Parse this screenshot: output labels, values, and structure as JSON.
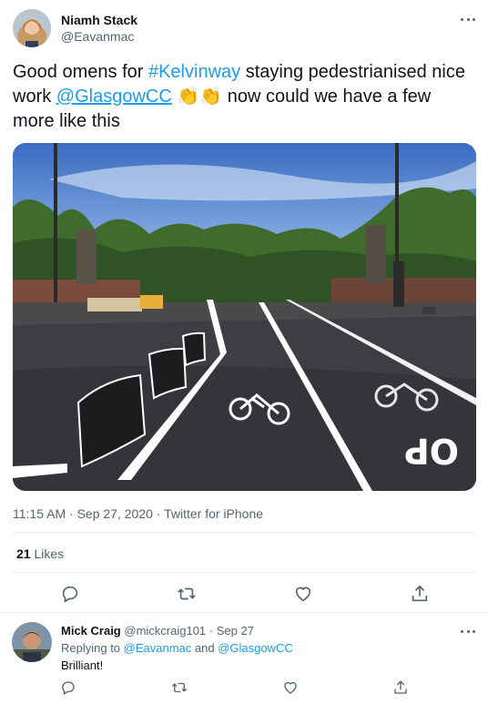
{
  "tweet": {
    "author_name": "Niamh Stack",
    "author_handle": "@Eavanmac",
    "text_part1": "Good omens for ",
    "hashtag": "#Kelvinway",
    "text_part2": " staying pedestrianised nice work ",
    "mention": "@GlasgowCC",
    "emoji": "👏👏",
    "text_part3": " now could we have a few more like this",
    "time": "11:15 AM",
    "date": "Sep 27, 2020",
    "source": "Twitter for iPhone",
    "likes_count": "21",
    "likes_label": "Likes"
  },
  "reply": {
    "author_name": "Mick Craig",
    "author_handle": "@mickcraig101",
    "date": "Sep 27",
    "replying_to_prefix": "Replying to ",
    "replying_to_1": "@Eavanmac",
    "replying_to_and": " and ",
    "replying_to_2": "@GlasgowCC",
    "text": "Brilliant!"
  },
  "icons": [
    "reply-icon",
    "retweet-icon",
    "like-icon",
    "share-icon",
    "more-icon"
  ],
  "colors": {
    "link": "#1d9bf0",
    "secondary": "#536471",
    "text": "#0f1419"
  }
}
